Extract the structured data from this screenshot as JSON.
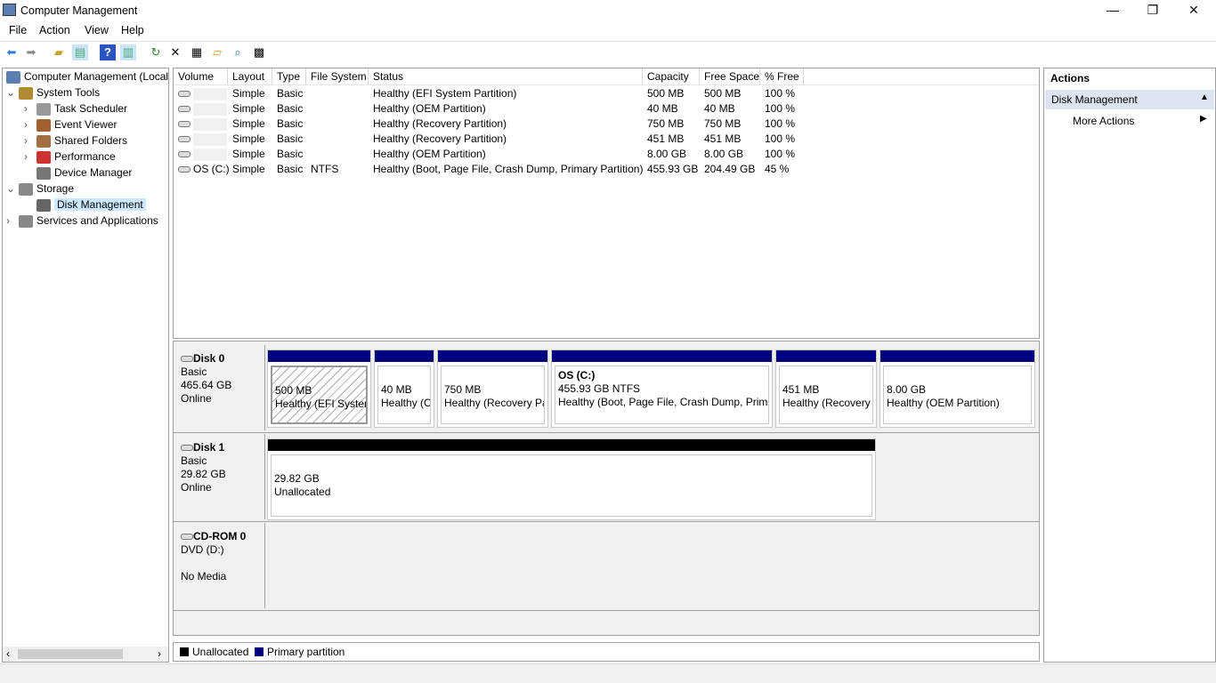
{
  "window": {
    "title": "Computer Management",
    "minimize": "—",
    "restore": "❐",
    "close": "✕"
  },
  "menu": [
    "File",
    "Action",
    "View",
    "Help"
  ],
  "toolbar": [
    "back-icon",
    "forward-icon",
    "up-folder-icon",
    "show-hide-tree-icon",
    "help-icon",
    "show-hide-action-icon",
    "refresh-icon",
    "delete-icon",
    "properties-icon",
    "open-icon",
    "search-icon",
    "settings-icon"
  ],
  "tree": [
    {
      "label": "Computer Management (Local",
      "level": 0,
      "chev": ""
    },
    {
      "label": "System Tools",
      "level": 1,
      "chev": "⌄"
    },
    {
      "label": "Task Scheduler",
      "level": 2,
      "chev": "›"
    },
    {
      "label": "Event Viewer",
      "level": 2,
      "chev": "›"
    },
    {
      "label": "Shared Folders",
      "level": 2,
      "chev": "›"
    },
    {
      "label": "Performance",
      "level": 2,
      "chev": "›"
    },
    {
      "label": "Device Manager",
      "level": 2,
      "chev": ""
    },
    {
      "label": "Storage",
      "level": 1,
      "chev": "⌄"
    },
    {
      "label": "Disk Management",
      "level": 2,
      "chev": "",
      "selected": true
    },
    {
      "label": "Services and Applications",
      "level": 1,
      "chev": "›"
    }
  ],
  "volumes": {
    "columns": [
      "Volume",
      "Layout",
      "Type",
      "File System",
      "Status",
      "Capacity",
      "Free Space",
      "% Free"
    ],
    "rows": [
      [
        "",
        "Simple",
        "Basic",
        "",
        "Healthy (EFI System Partition)",
        "500 MB",
        "500 MB",
        "100 %"
      ],
      [
        "",
        "Simple",
        "Basic",
        "",
        "Healthy (OEM Partition)",
        "40 MB",
        "40 MB",
        "100 %"
      ],
      [
        "",
        "Simple",
        "Basic",
        "",
        "Healthy (Recovery Partition)",
        "750 MB",
        "750 MB",
        "100 %"
      ],
      [
        "",
        "Simple",
        "Basic",
        "",
        "Healthy (Recovery Partition)",
        "451 MB",
        "451 MB",
        "100 %"
      ],
      [
        "",
        "Simple",
        "Basic",
        "",
        "Healthy (OEM Partition)",
        "8.00 GB",
        "8.00 GB",
        "100 %"
      ],
      [
        "OS (C:)",
        "Simple",
        "Basic",
        "NTFS",
        "Healthy (Boot, Page File, Crash Dump, Primary Partition)",
        "455.93 GB",
        "204.49 GB",
        "45 %"
      ]
    ]
  },
  "disks": [
    {
      "name": "Disk 0",
      "type": "Basic",
      "size": "465.64 GB",
      "status": "Online",
      "partitions": [
        {
          "title": "",
          "size": "500 MB",
          "status": "Healthy (EFI System Partition)",
          "hatched": true
        },
        {
          "title": "",
          "size": "40 MB",
          "status": "Healthy (OEM Partition)"
        },
        {
          "title": "",
          "size": "750 MB",
          "status": "Healthy (Recovery Partition)"
        },
        {
          "title": "OS  (C:)",
          "size": "455.93 GB NTFS",
          "status": "Healthy (Boot, Page File, Crash Dump, Primary Partition)"
        },
        {
          "title": "",
          "size": "451 MB",
          "status": "Healthy (Recovery Partition)"
        },
        {
          "title": "",
          "size": "8.00 GB",
          "status": "Healthy (OEM Partition)"
        }
      ]
    },
    {
      "name": "Disk 1",
      "type": "Basic",
      "size": "29.82 GB",
      "status": "Online",
      "partitions": [
        {
          "title": "",
          "size": "29.82 GB",
          "status": "Unallocated",
          "unallocated": true
        }
      ]
    },
    {
      "name": "CD-ROM 0",
      "type": "DVD (D:)",
      "size": "",
      "status": "No Media",
      "partitions": []
    }
  ],
  "legend": [
    {
      "label": "Unallocated",
      "color": "#000000"
    },
    {
      "label": "Primary partition",
      "color": "#00007f"
    }
  ],
  "actions": {
    "header": "Actions",
    "section": "Disk Management",
    "items": [
      "More Actions"
    ]
  },
  "colors": {
    "primary": "#00007f",
    "unallocated": "#000000",
    "selection": "#cce8ff",
    "section": "#dbe4f0"
  }
}
